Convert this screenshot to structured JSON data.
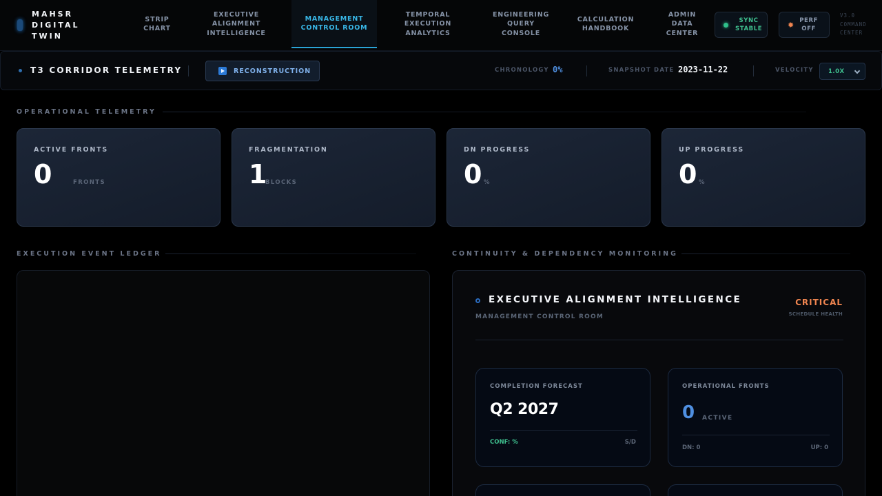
{
  "brand": {
    "name": "MAHSR\nDIGITAL\nTWIN"
  },
  "nav": {
    "items": [
      {
        "label": "STRIP\nCHART"
      },
      {
        "label": "EXECUTIVE\nALIGNMENT\nINTELLIGENCE"
      },
      {
        "label": "MANAGEMENT\nCONTROL ROOM",
        "active": true
      },
      {
        "label": "TEMPORAL\nEXECUTION\nANALYTICS"
      },
      {
        "label": "ENGINEERING\nQUERY CONSOLE"
      },
      {
        "label": "CALCULATION\nHANDBOOK"
      },
      {
        "label": "ADMIN\nDATA\nCENTER"
      }
    ],
    "sync_status": "SYNC\nSTABLE",
    "perf_status": "PERF\nOFF",
    "version": "V3.0\nCOMMAND\nCENTER"
  },
  "subheader": {
    "title": "T3 CORRIDOR TELEMETRY",
    "reconstruction_label": "RECONSTRUCTION",
    "chronology_label": "CHRONOLOGY",
    "chronology_value": "0%",
    "snapshot_label": "SNAPSHOT DATE",
    "snapshot_value": "2023-11-22",
    "velocity_label": "VELOCITY",
    "velocity_value": "1.0X"
  },
  "sections": {
    "operational": "OPERATIONAL TELEMETRY",
    "ledger": "EXECUTION EVENT LEDGER",
    "continuity": "CONTINUITY & DEPENDENCY MONITORING"
  },
  "stats": [
    {
      "label": "ACTIVE FRONTS",
      "value": "0",
      "unit": "FRONTS"
    },
    {
      "label": "FRAGMENTATION",
      "value": "1",
      "unit": "BLOCKS"
    },
    {
      "label": "DN PROGRESS",
      "value": "0",
      "unit": "%"
    },
    {
      "label": "UP PROGRESS",
      "value": "0",
      "unit": "%"
    }
  ],
  "continuity": {
    "title": "EXECUTIVE ALIGNMENT INTELLIGENCE",
    "subtitle": "MANAGEMENT CONTROL ROOM",
    "health_value": "CRITICAL",
    "health_label": "SCHEDULE HEALTH",
    "completion": {
      "label": "COMPLETION FORECAST",
      "value": "Q2 2027",
      "conf": "CONF: %",
      "sd": "S/D"
    },
    "fronts": {
      "label": "OPERATIONAL FRONTS",
      "value": "0",
      "unit": "ACTIVE",
      "dn": "DN: 0",
      "up": "UP: 0"
    }
  },
  "colors": {
    "accent": "#39b8e8",
    "sync_green": "#3fc08f",
    "perf_orange": "#f08550",
    "critical": "#f08550",
    "chronology_blue": "#4f8fe0"
  }
}
